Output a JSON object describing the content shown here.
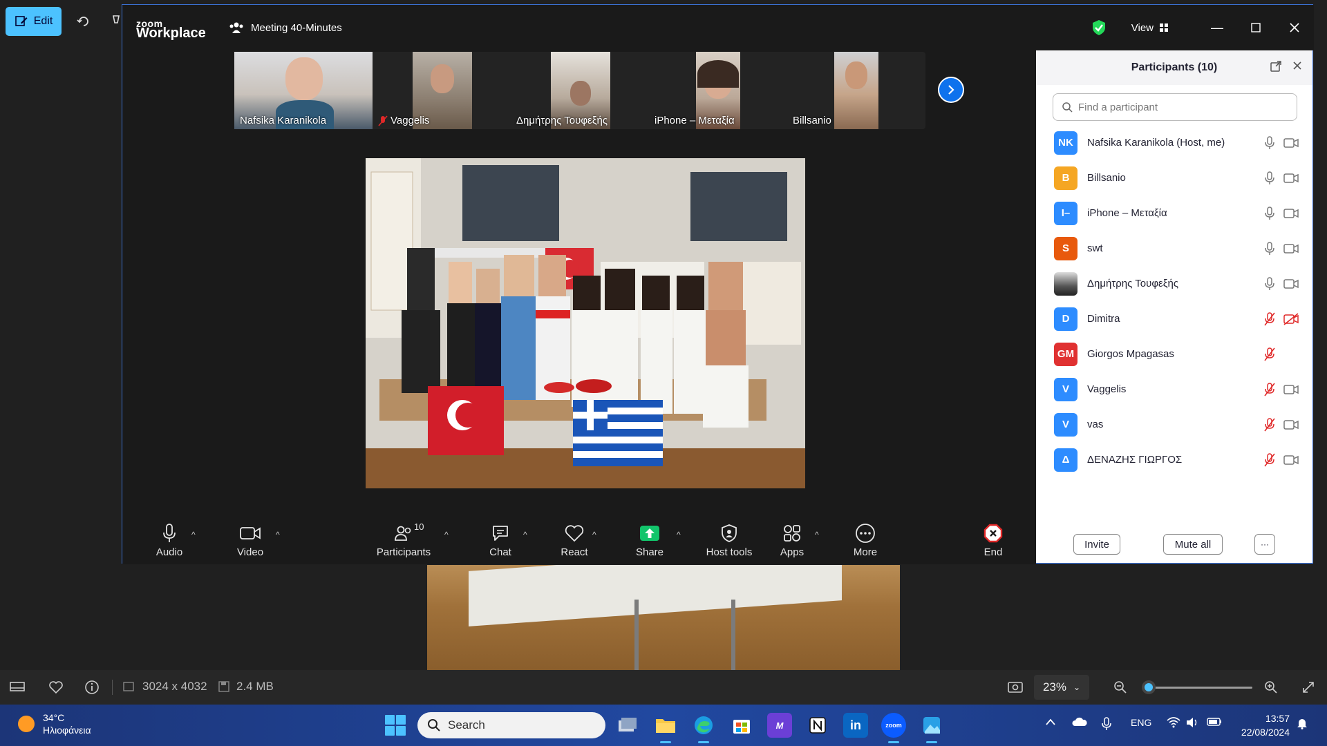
{
  "photos_app": {
    "edit_label": "Edit",
    "dimensions": "3024 x 4032",
    "file_size": "2.4 MB",
    "zoom_level": "23%"
  },
  "zoom": {
    "logo_top": "zoom",
    "logo_bottom": "Workplace",
    "meeting_title": "Meeting 40-Minutes",
    "view_label": "View",
    "thumbnails": [
      {
        "name": "Nafsika Karanikola",
        "muted": false
      },
      {
        "name": "Vaggelis",
        "muted": true
      },
      {
        "name": "Δημήτρης Τουφεξής",
        "muted": false
      },
      {
        "name": "iPhone – Μεταξία",
        "muted": false
      },
      {
        "name": "Billsanio",
        "muted": false
      }
    ],
    "toolbar": {
      "audio": "Audio",
      "video": "Video",
      "participants": "Participants",
      "participants_count": "10",
      "chat": "Chat",
      "react": "React",
      "share": "Share",
      "host_tools": "Host tools",
      "apps": "Apps",
      "more": "More",
      "end": "End"
    },
    "participants_panel": {
      "title": "Participants (10)",
      "search_placeholder": "Find a participant",
      "invite": "Invite",
      "mute_all": "Mute all",
      "more": "···",
      "participants": [
        {
          "initials": "NK",
          "name": "Nafsika Karanikola (Host, me)",
          "color": "#2d8cff",
          "mic_muted": false,
          "video_off": false
        },
        {
          "initials": "B",
          "name": "Billsanio",
          "color": "#f5a623",
          "mic_muted": false,
          "video_off": false
        },
        {
          "initials": "I–",
          "name": "iPhone – Μεταξία",
          "color": "#2d8cff",
          "mic_muted": false,
          "video_off": false
        },
        {
          "initials": "S",
          "name": "swt",
          "color": "#e8590c",
          "mic_muted": false,
          "video_off": false
        },
        {
          "initials": "",
          "name": "Δημήτρης Τουφεξής",
          "color": "#777777",
          "mic_muted": false,
          "video_off": false
        },
        {
          "initials": "D",
          "name": "Dimitra",
          "color": "#2d8cff",
          "mic_muted": true,
          "video_off": true
        },
        {
          "initials": "GM",
          "name": "Giorgos Mpagasas",
          "color": "#e03131",
          "mic_muted": true,
          "video_off": null
        },
        {
          "initials": "V",
          "name": "Vaggelis",
          "color": "#2d8cff",
          "mic_muted": true,
          "video_off": false
        },
        {
          "initials": "V",
          "name": "vas",
          "color": "#2d8cff",
          "mic_muted": true,
          "video_off": false
        },
        {
          "initials": "Δ",
          "name": "ΔΕΝΑΖΗΣ ΓΙΩΡΓΟΣ",
          "color": "#2d8cff",
          "mic_muted": true,
          "video_off": false
        }
      ]
    }
  },
  "taskbar": {
    "weather_temp": "34°C",
    "weather_desc": "Ηλιοφάνεια",
    "search_label": "Search",
    "language": "ENG",
    "time": "13:57",
    "date": "22/08/2024"
  },
  "colors": {
    "zoom_blue": "#0e72ed",
    "share_green": "#12c46b",
    "end_red": "#e02828",
    "muted_red": "#e02828"
  }
}
